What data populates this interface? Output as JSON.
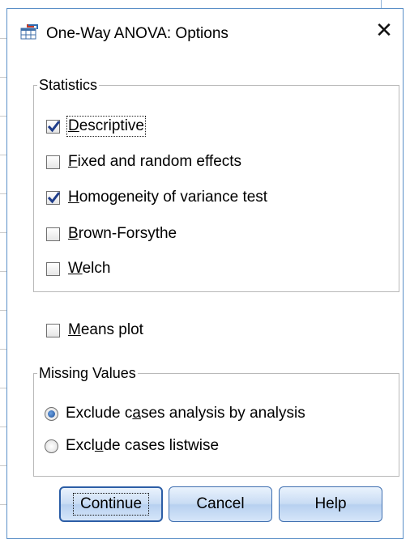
{
  "dialog": {
    "title": "One-Way ANOVA: Options",
    "close_glyph": "✕"
  },
  "statistics": {
    "legend": "Statistics",
    "items": [
      {
        "prefix": "",
        "key": "D",
        "suffix": "escriptive",
        "checked": true
      },
      {
        "prefix": "",
        "key": "F",
        "suffix": "ixed and random effects",
        "checked": false
      },
      {
        "prefix": "",
        "key": "H",
        "suffix": "omogeneity of variance test",
        "checked": true
      },
      {
        "prefix": "",
        "key": "B",
        "suffix": "rown-Forsythe",
        "checked": false
      },
      {
        "prefix": "",
        "key": "W",
        "suffix": "elch",
        "checked": false
      }
    ]
  },
  "means_plot": {
    "prefix": "",
    "key": "M",
    "suffix": "eans plot",
    "checked": false
  },
  "missing": {
    "legend": "Missing Values",
    "options": [
      {
        "prefix": "Exclude c",
        "key": "a",
        "suffix": "ses analysis by analysis",
        "selected": true
      },
      {
        "prefix": "Excl",
        "key": "u",
        "suffix": "de cases listwise",
        "selected": false
      }
    ]
  },
  "buttons": {
    "continue": "Continue",
    "cancel": "Cancel",
    "help": "Help"
  },
  "colors": {
    "check": "#1f3d8a",
    "dialog_border": "#5a8fc7",
    "button_border": "#3f6fb0"
  }
}
